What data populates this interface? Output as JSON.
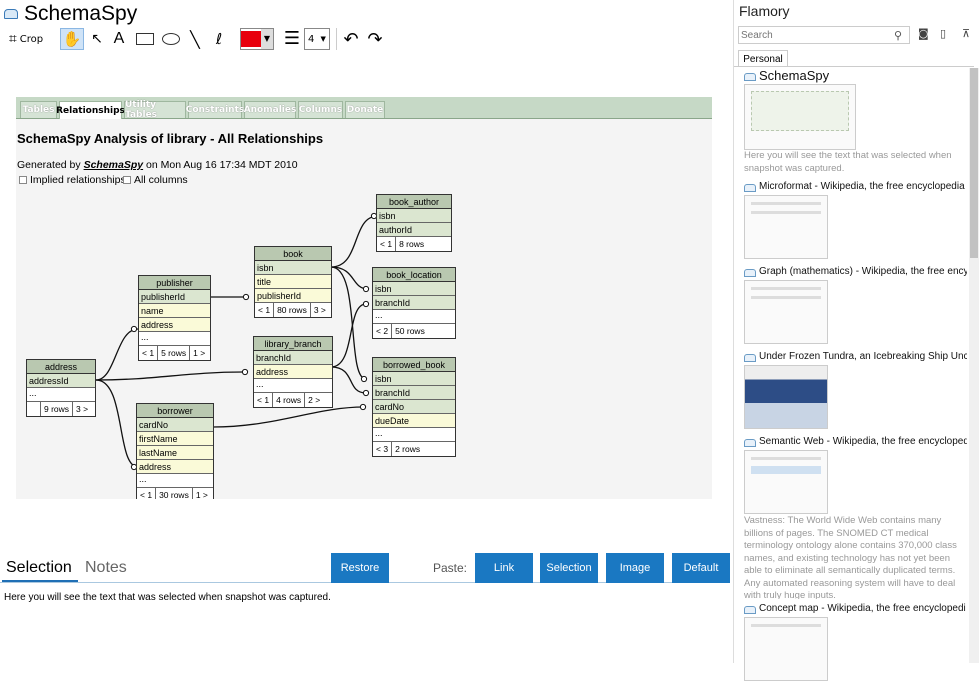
{
  "app": {
    "title": "SchemaSpy"
  },
  "toolbar": {
    "crop_label": "Crop",
    "text_tool_label": "A",
    "line_width_value": "4",
    "color": "#e8000d"
  },
  "document": {
    "tabs": [
      "Tables",
      "Relationships",
      "Utility Tables",
      "Constraints",
      "Anomalies",
      "Columns",
      "Donate"
    ],
    "active_tab": "Relationships",
    "heading": "SchemaSpy Analysis of library - All Relationships",
    "generated_prefix": "Generated by",
    "generated_link": "SchemaSpy",
    "generated_suffix": "on Mon Aug 16 17:34 MDT 2010",
    "checkbox_implied": "Implied relationships",
    "checkbox_all_columns": "All columns"
  },
  "erd": {
    "address": {
      "name": "address",
      "pk": [
        "addressId"
      ],
      "cols": [],
      "foot": [
        "9 rows",
        "3 >"
      ]
    },
    "publisher": {
      "name": "publisher",
      "pk": [
        "publisherId"
      ],
      "cols": [
        "name",
        "address"
      ],
      "foot": [
        "< 1",
        "5 rows",
        "1 >"
      ]
    },
    "book": {
      "name": "book",
      "pk": [
        "isbn"
      ],
      "cols": [
        "title",
        "publisherId"
      ],
      "foot": [
        "< 1",
        "80 rows",
        "3 >"
      ]
    },
    "library_branch": {
      "name": "library_branch",
      "pk": [
        "branchId"
      ],
      "cols": [
        "address"
      ],
      "foot": [
        "< 1",
        "4 rows",
        "2 >"
      ]
    },
    "borrower": {
      "name": "borrower",
      "pk": [
        "cardNo"
      ],
      "cols": [
        "firstName",
        "lastName",
        "address"
      ],
      "foot": [
        "< 1",
        "30 rows",
        "1 >"
      ]
    },
    "book_author": {
      "name": "book_author",
      "pk": [
        "isbn",
        "authorId"
      ],
      "cols": [],
      "foot": [
        "< 1",
        "8 rows"
      ]
    },
    "book_location": {
      "name": "book_location",
      "pk": [
        "isbn",
        "branchId"
      ],
      "cols": [],
      "foot": [
        "< 2",
        "50 rows"
      ]
    },
    "borrowed_book": {
      "name": "borrowed_book",
      "pk": [
        "isbn",
        "branchId",
        "cardNo"
      ],
      "cols": [
        "dueDate"
      ],
      "foot": [
        "< 3",
        "2 rows"
      ]
    }
  },
  "bottom": {
    "tab_selection": "Selection",
    "tab_notes": "Notes",
    "restore": "Restore",
    "paste_label": "Paste:",
    "link": "Link",
    "selection": "Selection",
    "image": "Image",
    "default": "Default",
    "selection_text": "Here you will see the text that was selected when snapshot was captured."
  },
  "flamory": {
    "title": "Flamory",
    "search_placeholder": "Search",
    "tab_personal": "Personal",
    "snapshots": [
      {
        "title": "SchemaSpy",
        "text": [
          "Here you will see the text that was selected when",
          "snapshot was captured."
        ]
      },
      {
        "title": "Microformat - Wikipedia, the free encyclopedia",
        "text": []
      },
      {
        "title": "Graph (mathematics) - Wikipedia, the free encyc",
        "text": []
      },
      {
        "title": "Under Frozen Tundra, an Icebreaking Ship Unco",
        "text": []
      },
      {
        "title": "Semantic Web - Wikipedia, the free encycloped",
        "text": [
          "Vastness: The World Wide Web contains many",
          "billions of pages. The SNOMED CT medical",
          "terminology ontology alone contains 370,000 class",
          "names, and existing technology has not yet been",
          "able to eliminate all semantically duplicated terms.",
          "Any automated reasoning system will have to deal",
          "with truly huge inputs."
        ]
      },
      {
        "title": "Concept map - Wikipedia, the free encyclopedi",
        "text": []
      }
    ]
  }
}
